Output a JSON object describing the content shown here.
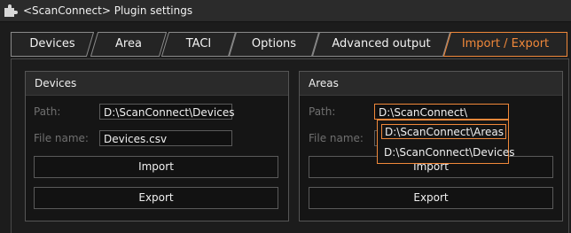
{
  "window": {
    "title": "<ScanConnect> Plugin settings",
    "icon": "puzzle-icon"
  },
  "tabs": [
    {
      "label": "Devices",
      "active": false
    },
    {
      "label": "Area",
      "active": false
    },
    {
      "label": "TACI",
      "active": false
    },
    {
      "label": "Options",
      "active": false
    },
    {
      "label": "Advanced output",
      "active": false
    },
    {
      "label": "Import / Export",
      "active": true
    }
  ],
  "devices_group": {
    "title": "Devices",
    "path_label": "Path:",
    "path_value": "D:\\ScanConnect\\Devices",
    "filename_label": "File name:",
    "filename_value": "Devices.csv",
    "import_label": "Import",
    "export_label": "Export"
  },
  "areas_group": {
    "title": "Areas",
    "path_label": "Path:",
    "path_value": "D:\\ScanConnect\\",
    "filename_label": "File name:",
    "import_label": "Import",
    "export_label": "Export",
    "suggestions": [
      {
        "label": "D:\\ScanConnect\\Areas",
        "selected": true
      },
      {
        "label": "D:\\ScanConnect\\Devices",
        "selected": false
      }
    ]
  },
  "colors": {
    "accent": "#f0883a",
    "background": "#1c1c1c",
    "tab_fill": "#242424",
    "border": "#5a5a5a"
  }
}
